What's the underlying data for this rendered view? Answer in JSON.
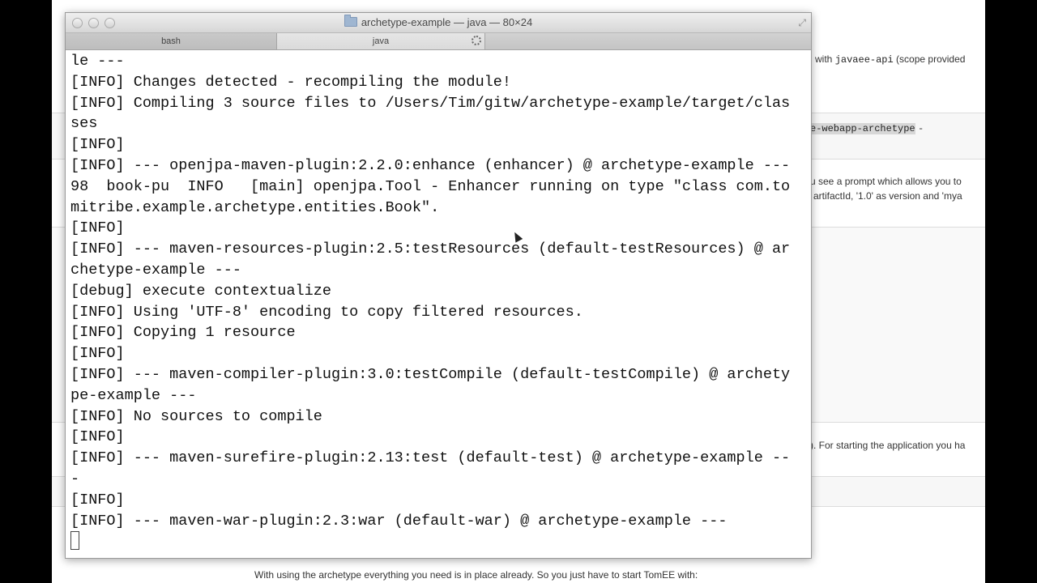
{
  "window": {
    "title": "archetype-example — java — 80×24",
    "tabs": [
      {
        "label": "bash"
      },
      {
        "label": "java"
      }
    ]
  },
  "terminal": {
    "lines": [
      "le ---",
      "[INFO] Changes detected - recompiling the module!",
      "[INFO] Compiling 3 source files to /Users/Tim/gitw/archetype-example/target/clas",
      "ses",
      "[INFO]",
      "[INFO] --- openjpa-maven-plugin:2.2.0:enhance (enhancer) @ archetype-example ---",
      "98  book-pu  INFO   [main] openjpa.Tool - Enhancer running on type \"class com.to",
      "mitribe.example.archetype.entities.Book\".",
      "[INFO]",
      "[INFO] --- maven-resources-plugin:2.5:testResources (default-testResources) @ ar",
      "chetype-example ---",
      "[debug] execute contextualize",
      "[INFO] Using 'UTF-8' encoding to copy filtered resources.",
      "[INFO] Copying 1 resource",
      "[INFO]",
      "[INFO] --- maven-compiler-plugin:3.0:testCompile (default-testCompile) @ archety",
      "pe-example ---",
      "[INFO] No sources to compile",
      "[INFO]",
      "[INFO] --- maven-surefire-plugin:2.13:test (default-test) @ archetype-example --",
      "-",
      "[INFO]",
      "[INFO] --- maven-war-plugin:2.3:war (default-war) @ archetype-example ---"
    ]
  },
  "background_page": {
    "line1_prefix": "l with",
    "line1_code": "javaee-api",
    "line1_suffix": "(scope provided",
    "line2_code": "e-webapp-archetype",
    "line2_suffix": "-",
    "line3": "u see a prompt which allows you to",
    "line4": "artifactId, '1.0' as version and 'mya",
    "line5": "). For starting the application you ha",
    "bottom_text": "With using the archetype everything you need is in place already. So you just have to start TomEE with:"
  }
}
